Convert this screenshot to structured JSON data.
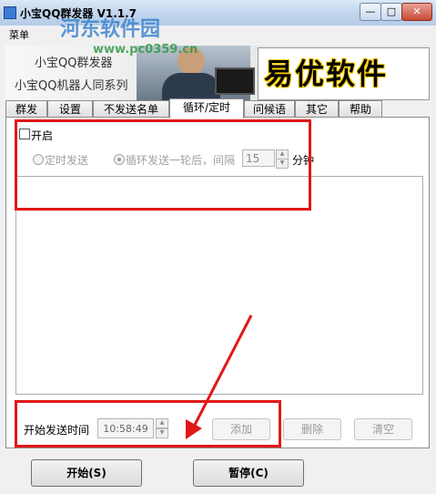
{
  "window": {
    "title": "小宝QQ群发器 V1.1.7",
    "controls": {
      "minimize": "—",
      "maximize": "□",
      "close": "✕"
    }
  },
  "menu": {
    "item_1": "菜单"
  },
  "watermark": {
    "text": "河东软件园",
    "url": "www.pc0359.cn"
  },
  "banner": {
    "title": "小宝QQ群发器",
    "subtitle": "小宝QQ机器人同系列",
    "logo": "易优软件"
  },
  "tabs": [
    {
      "label": "群发",
      "active": false
    },
    {
      "label": "设置",
      "active": false
    },
    {
      "label": "不发送名单",
      "active": false
    },
    {
      "label": "循环/定时",
      "active": true
    },
    {
      "label": "问候语",
      "active": false
    },
    {
      "label": "其它",
      "active": false
    },
    {
      "label": "帮助",
      "active": false
    }
  ],
  "loop_panel": {
    "enable_label": "开启",
    "enable_checked": false,
    "radio_timed_label": "定时发送",
    "radio_loop_label": "循环发送一轮后，间隔",
    "radio_selected": "loop",
    "interval_value": "15",
    "interval_unit": "分钟",
    "start_time_label": "开始发送时间",
    "start_time_value": "10:58:49",
    "add_label": "添加",
    "delete_label": "删除",
    "clear_label": "清空"
  },
  "footer": {
    "start_label": "开始(S)",
    "pause_label": "暂停(C)"
  },
  "colors": {
    "annotation": "#e01818",
    "title_gradient_top": "#dbe8f6",
    "panel_background": "#ffffff"
  }
}
